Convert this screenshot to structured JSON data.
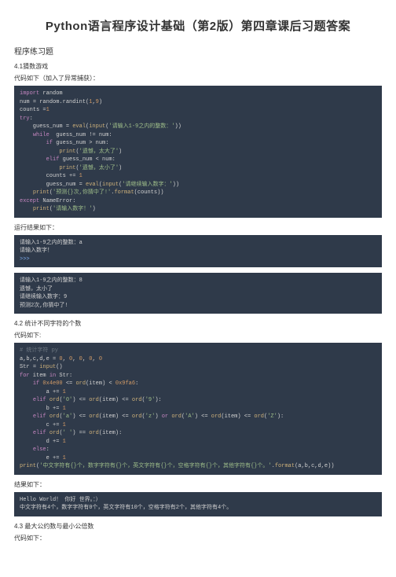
{
  "title": "Python语言程序设计基础（第2版）第四章课后习题答案",
  "sectionHeader": "程序练习题",
  "ex1": {
    "title": "4.1猜数游戏",
    "codeIntro": "代码如下（加入了异常捕获）：",
    "code": {
      "l1a": "import",
      "l1b": " random",
      "l2a": "num ",
      "l2b": "=",
      "l2c": " random.randint(",
      "l2d": "1",
      "l2e": ",",
      "l2f": "9",
      "l2g": ")",
      "l3a": "counts ",
      "l3b": "=",
      "l3c": "1",
      "l4": "try",
      "l5a": "    guess_num ",
      "l5b": "= ",
      "l5c": "eval",
      "l5d": "(",
      "l5e": "input",
      "l5f": "(",
      "l5g": "'请输入1-9之内的整数：'",
      "l5h": "))",
      "l6a": "    ",
      "l6b": "while",
      "l6c": "  guess_num ",
      "l6d": "!=",
      "l6e": " num:",
      "l7a": "        ",
      "l7b": "if",
      "l7c": " guess_num ",
      "l7d": ">",
      "l7e": " num:",
      "l8a": "            ",
      "l8b": "print",
      "l8c": "(",
      "l8d": "'遗憾，太大了'",
      "l8e": ")",
      "l9a": "        ",
      "l9b": "elif",
      "l9c": " guess_num ",
      "l9d": "<",
      "l9e": " num:",
      "l10a": "            ",
      "l10b": "print",
      "l10c": "(",
      "l10d": "'遗憾，太小了'",
      "l10e": ")",
      "l11a": "        counts ",
      "l11b": "+=",
      "l11c": " ",
      "l11d": "1",
      "l12a": "        guess_num ",
      "l12b": "= ",
      "l12c": "eval",
      "l12d": "(",
      "l12e": "input",
      "l12f": "(",
      "l12g": "'请继续输入数字：'",
      "l12h": "))",
      "l13a": "    ",
      "l13b": "print",
      "l13c": "(",
      "l13d": "'预测{}次,你猜中了!'",
      "l13e": ".",
      "l13f": "format",
      "l13g": "(counts))",
      "l14a": "except",
      "l14b": " NameError:",
      "l15a": "    ",
      "l15b": "print",
      "l15c": "(",
      "l15d": "'请输入数字！'",
      "l15e": ")"
    },
    "runLabel": "运行结果如下：",
    "out1": {
      "l1": "请输入1-9之内的整数：a",
      "l2": "请输入数字！",
      "l3": ">>>"
    },
    "out2": {
      "l1": "请输入1-9之内的整数：8",
      "l2": "遗憾，太小了",
      "l3": "请继续输入数字：9",
      "l4": "预测2次,你猜中了!"
    }
  },
  "ex2": {
    "title": "4.2 统计不同字符的个数",
    "codeIntro": "代码如下:",
    "code": {
      "l1": "# 统计字符 py",
      "l2a": "a,b,c,d,e ",
      "l2b": "=",
      "l2c": " ",
      "l2d": "0",
      "l2e": ", ",
      "l2f": "0",
      "l2g": ", ",
      "l2h": "0",
      "l2i": ", ",
      "l2j": "0",
      "l2k": ", ",
      "l2l": "0",
      "l3a": "Str ",
      "l3b": "= ",
      "l3c": "input",
      "l3d": "()",
      "l4a": "for",
      "l4b": " item ",
      "l4c": "in",
      "l4d": " Str:",
      "l5a": "    ",
      "l5b": "if",
      "l5c": " ",
      "l5d": "0x4e00",
      "l5e": " <= ",
      "l5f": "ord",
      "l5g": "(item) ",
      "l5h": "< ",
      "l5i": "0x9fa6",
      "l5j": ":",
      "l6a": "        a ",
      "l6b": "+=",
      "l6c": " ",
      "l6d": "1",
      "l7a": "    ",
      "l7b": "elif ",
      "l7c": "ord",
      "l7d": "(",
      "l7e": "'0'",
      "l7f": ") ",
      "l7g": "<= ",
      "l7h": "ord",
      "l7i": "(item) ",
      "l7j": "<= ",
      "l7k": "ord",
      "l7l": "(",
      "l7m": "'9'",
      "l7n": "):",
      "l8a": "        b ",
      "l8b": "+=",
      "l8c": " ",
      "l8d": "1",
      "l9a": "    ",
      "l9b": "elif ",
      "l9c": "ord",
      "l9d": "(",
      "l9e": "'a'",
      "l9f": ") ",
      "l9g": "<= ",
      "l9h": "ord",
      "l9i": "(item) ",
      "l9j": "<= ",
      "l9k": "ord",
      "l9l": "(",
      "l9m": "'z'",
      "l9n": ") ",
      "l9o": "or ",
      "l9p": "ord",
      "l9q": "(",
      "l9r": "'A'",
      "l9s": ") ",
      "l9t": "<= ",
      "l9u": "ord",
      "l9v": "(item) ",
      "l9w": "<= ",
      "l9x": "ord",
      "l9y": "(",
      "l9z": "'Z'",
      "l9aa": "):",
      "l10a": "        c ",
      "l10b": "+=",
      "l10c": " ",
      "l10d": "1",
      "l11a": "    ",
      "l11b": "elif ",
      "l11c": "ord",
      "l11d": "(",
      "l11e": "' '",
      "l11f": ") ",
      "l11g": "== ",
      "l11h": "ord",
      "l11i": "(item):",
      "l12a": "        d ",
      "l12b": "+=",
      "l12c": " ",
      "l12d": "1",
      "l13a": "    ",
      "l13b": "else",
      "l13c": ":",
      "l14a": "        e ",
      "l14b": "+=",
      "l14c": " ",
      "l14d": "1",
      "l15a": "print",
      "l15b": "(",
      "l15c": "'中文字符有{}个，数字字符有{}个，英文字符有{}个，空格字符有{}个，其他字符有{}个。'",
      "l15d": ".",
      "l15e": "format",
      "l15f": "(a,b,c,d,e))"
    },
    "resultLabel": "结果如下：",
    "out": {
      "l1": "Hello World！ 你好 世界。：）",
      "l2": "中文字符有4个，数字字符有0个，英文字符有10个，空格字符有2个，其他字符有4个。"
    }
  },
  "ex3": {
    "title": "4.3 最大公约数与最小公倍数",
    "codeIntro": "代码如下："
  }
}
